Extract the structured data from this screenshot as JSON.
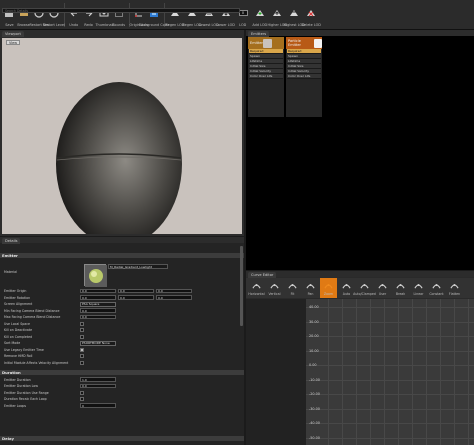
{
  "toolbar": {
    "buttons": [
      {
        "label": "Save",
        "icon": "save-icon"
      },
      {
        "label": "Browse",
        "icon": "browse-icon"
      },
      {
        "label": "Restart Sim",
        "icon": "restart-sim-icon"
      },
      {
        "label": "Restart Level",
        "icon": "restart-level-icon"
      },
      {
        "label": "Undo",
        "icon": "undo-icon"
      },
      {
        "label": "Redo",
        "icon": "redo-icon"
      },
      {
        "label": "Thumbnail",
        "icon": "thumbnail-icon"
      },
      {
        "label": "Bounds",
        "icon": "bounds-icon"
      },
      {
        "label": "Origin Axis",
        "icon": "origin-axis-icon"
      },
      {
        "label": "Background Color",
        "icon": "background-color-icon"
      },
      {
        "label": "Regen LOD",
        "icon": "regen-lod-icon"
      },
      {
        "label": "Regen LOD",
        "icon": "regen-lod-icon"
      },
      {
        "label": "Lowest LOD",
        "icon": "lowest-lod-icon"
      },
      {
        "label": "Lower LOD",
        "icon": "lower-lod-icon"
      },
      {
        "label": "LOD",
        "icon": "lod-icon"
      },
      {
        "label": "Add LOD",
        "icon": "add-lod-icon"
      },
      {
        "label": "Higher LOD",
        "icon": "higher-lod-icon"
      },
      {
        "label": "Highest LOD",
        "icon": "highest-lod-icon"
      },
      {
        "label": "Delete LOD",
        "icon": "delete-lod-icon"
      }
    ],
    "lod_value": "0"
  },
  "viewport": {
    "tab": "Viewport",
    "view_button": "View",
    "background_color": "#c9c2bd"
  },
  "emitters": {
    "tab": "Emitters",
    "items": [
      {
        "name": "Emitter",
        "thumb_color": "#c9c2bd",
        "modules": [
          "Required",
          "Spawn",
          "Lifetime",
          "Initial Size",
          "Initial Velocity",
          "Color Over Life"
        ],
        "selected": 0
      },
      {
        "name": "Particle Emitter",
        "thumb_color": "#f3f3f3",
        "modules": [
          "Required",
          "Spawn",
          "Lifetime",
          "Initial Size",
          "Initial Velocity",
          "Color Over Life"
        ],
        "selected": 0
      }
    ]
  },
  "details": {
    "tab": "Details",
    "search_placeholder": "Search Details",
    "categories": {
      "emitter": "Emitter",
      "duration": "Duration",
      "delay": "Delay"
    },
    "material": {
      "label": "Material",
      "value": "M_Radial_Gradient_Lowlight"
    },
    "emitter_props": [
      {
        "label": "Emitter Origin",
        "values": [
          "0.0",
          "0.0",
          "0.0"
        ]
      },
      {
        "label": "Emitter Rotation",
        "values": [
          "0.0",
          "0.0",
          "0.0"
        ]
      },
      {
        "label": "Screen Alignment",
        "dropdown": "PSA Square"
      },
      {
        "label": "Min Facing Camera Blend Distance",
        "value": "0.0"
      },
      {
        "label": "Max Facing Camera Blend Distance",
        "value": "0.0"
      },
      {
        "label": "Use Local Space",
        "checkbox": false
      },
      {
        "label": "Kill on Deactivate",
        "checkbox": false
      },
      {
        "label": "Kill on Completed",
        "checkbox": false
      },
      {
        "label": "Sort Mode",
        "dropdown": "PSORTMODE None"
      },
      {
        "label": "Use Legacy Emitter Time",
        "checkbox": true
      },
      {
        "label": "Remove HMD Roll",
        "checkbox": false
      },
      {
        "label": "Initial Module Affects Velocity Alignment",
        "checkbox": false
      }
    ],
    "duration_props": [
      {
        "label": "Emitter Duration",
        "value": "1.0"
      },
      {
        "label": "Emitter Duration Low",
        "value": "0.0"
      },
      {
        "label": "Emitter Duration Use Range",
        "checkbox": false
      },
      {
        "label": "Duration Recalc Each Loop",
        "checkbox": false
      },
      {
        "label": "Emitter Loops",
        "value": "0"
      }
    ]
  },
  "curve_editor": {
    "tab": "Curve Editor",
    "tools": [
      "Horizontal",
      "Vertical",
      "Fit",
      "Pan",
      "Zoom",
      "Auto",
      "Auto/Clamped",
      "User",
      "Break",
      "Linear",
      "Constant",
      "Flatten"
    ],
    "y_ticks": [
      "40.00",
      "30.00",
      "20.00",
      "10.00",
      "0.00",
      "-10.00",
      "-20.00",
      "-30.00",
      "-40.00",
      "-50.00"
    ]
  }
}
